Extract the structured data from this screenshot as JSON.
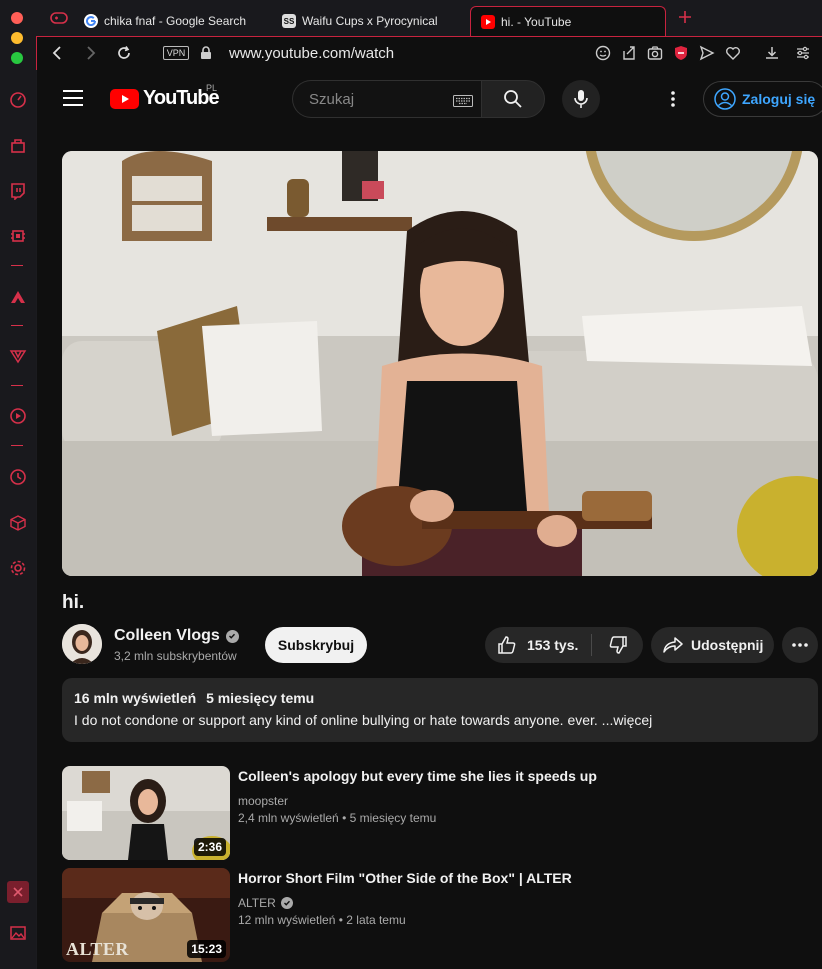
{
  "tabs": [
    {
      "label": "chika fnaf - Google Search",
      "favicon": "google-icon"
    },
    {
      "label": "Waifu Cups x Pyrocynical",
      "favicon": "ss-icon"
    },
    {
      "label": "hi. - YouTube",
      "favicon": "youtube-icon"
    }
  ],
  "address": {
    "url": "www.youtube.com/watch",
    "vpn_label": "VPN"
  },
  "header": {
    "logo_text": "YouTube",
    "country_code": "PL",
    "search_placeholder": "Szukaj",
    "signin_label": "Zaloguj się"
  },
  "video": {
    "title": "hi.",
    "channel_name": "Colleen Vlogs",
    "subscribers": "3,2 mln subskrybentów",
    "subscribe_label": "Subskrybuj",
    "like_count": "153 tys.",
    "share_label": "Udostępnij",
    "views": "16 mln wyświetleń",
    "age": "5 miesięcy temu",
    "description": "I do not condone or support any kind of online bullying or hate towards anyone. ever. ...więcej"
  },
  "recommendations": [
    {
      "title": "Colleen's apology but every time she lies it speeds up",
      "channel": "moopster",
      "verified": false,
      "views": "2,4 mln wyświetleń",
      "age": "5 miesięcy temu",
      "duration": "2:36"
    },
    {
      "title": "Horror Short Film \"Other Side of the Box\" | ALTER",
      "channel": "ALTER",
      "verified": true,
      "views": "12 mln wyświetleń",
      "age": "2 lata temu",
      "duration": "15:23",
      "thumb_watermark": "ALTER"
    }
  ],
  "colors": {
    "accent": "#c8233f",
    "youtube_red": "#ff0000",
    "link_blue": "#3ea6ff"
  }
}
